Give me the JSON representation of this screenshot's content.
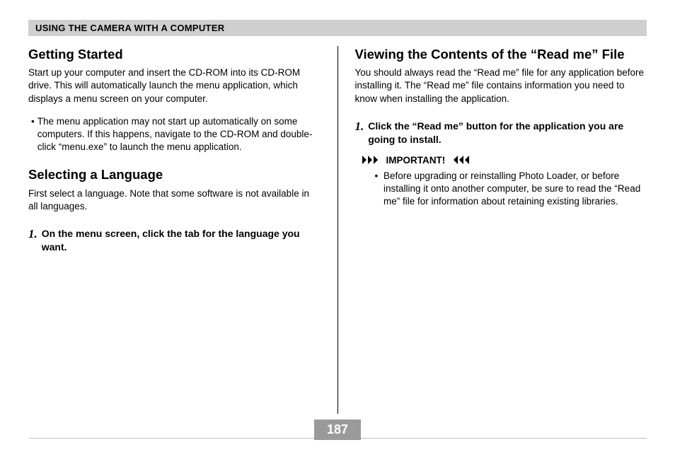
{
  "header": {
    "title": "USING THE CAMERA WITH A COMPUTER"
  },
  "left": {
    "section1": {
      "heading": "Getting Started",
      "para": "Start up your computer and insert the CD-ROM into its CD-ROM drive. This will automatically launch the menu application, which displays a menu screen on your computer.",
      "bullet": "The menu application may not start up automatically on some computers. If this happens, navigate to the CD-ROM and double-click “menu.exe” to launch the menu application."
    },
    "section2": {
      "heading": "Selecting a Language",
      "para": "First select a language. Note that some software is not available in all languages.",
      "step_num": "1.",
      "step_text": "On the menu screen, click the tab for the language you want."
    }
  },
  "right": {
    "section1": {
      "heading": "Viewing the Contents of the “Read me” File",
      "para": "You should always read the “Read me” file for any application before installing it. The “Read me” file contains information you need to know when installing the application.",
      "step_num": "1.",
      "step_text": "Click the “Read me” button for the application you are going to install.",
      "important_label": "IMPORTANT!",
      "important_bullet": "Before upgrading or reinstalling Photo Loader, or before installing it onto another computer, be sure to read the “Read me” file for information about retaining existing libraries."
    }
  },
  "footer": {
    "page_number": "187"
  }
}
